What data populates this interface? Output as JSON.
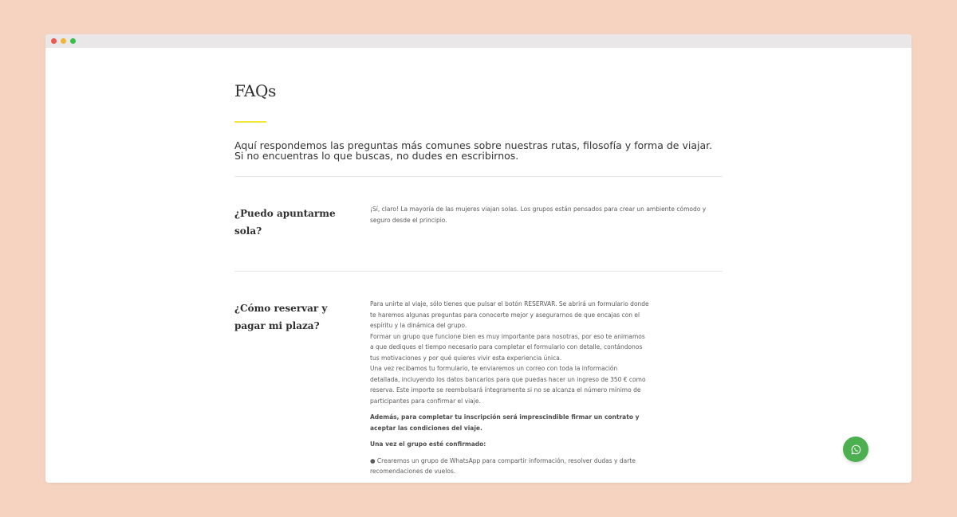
{
  "colors": {
    "accent": "#f3e83a",
    "whatsapp": "#4caf50"
  },
  "page": {
    "title": "FAQs",
    "intro": "Aquí respondemos las preguntas más comunes sobre nuestras rutas, filosofía y forma de viajar. Si no encuentras lo que buscas, no dudes en escribirnos."
  },
  "faqs": [
    {
      "question": "¿Puedo apuntarme sola?",
      "answer": "¡Sí, claro! La mayoría de las mujeres viajan solas. Los grupos están pensados para crear un ambiente cómodo y seguro desde el principio."
    },
    {
      "question": "¿Cómo reservar y pagar mi plaza?",
      "answer_p1": "Para unirte al viaje, sólo tienes que pulsar el botón RESERVAR. Se abrirá un formulario donde te haremos algunas preguntas para conocerte mejor y asegurarnos de que encajas con el espíritu y la dinámica del grupo.",
      "answer_p2": "Formar un grupo que funcione bien es muy importante para nosotras, por eso te animamos a que dediques el tiempo necesario para completar el formulario con detalle, contándonos tus motivaciones y por qué quieres vivir esta experiencia única.",
      "answer_p3": "Una vez recibamos tu formulario, te enviaremos un correo con toda la información detallada, incluyendo los datos bancarios para que puedas hacer un ingreso de 350 € como reserva. Este importe se reembolsará íntegramente si no se alcanza el número mínimo de participantes para confirmar el viaje.",
      "answer_bold1": "Además, para completar tu inscripción será imprescindible firmar un contrato y aceptar las condiciones del viaje.",
      "answer_bold2": "Una vez el grupo esté confirmado:",
      "answer_bullet1": "● Crearemos un grupo de WhatsApp para compartir información, resolver dudas y darte recomendaciones de vuelos."
    }
  ],
  "whatsapp": {
    "icon": "whatsapp-icon"
  }
}
